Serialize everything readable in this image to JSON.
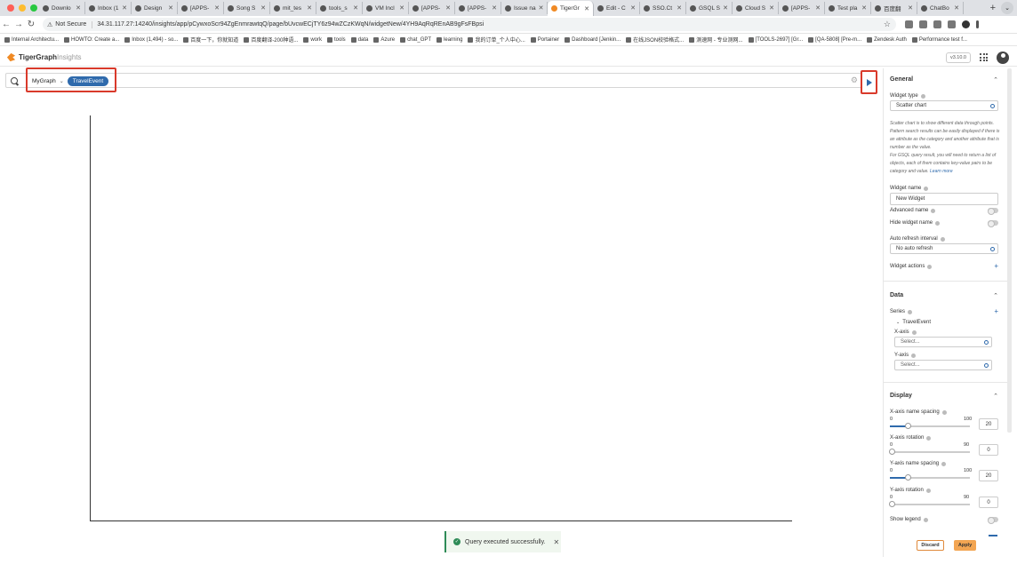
{
  "browser": {
    "tabs": [
      {
        "label": "Downlo"
      },
      {
        "label": "Inbox (1"
      },
      {
        "label": "Design"
      },
      {
        "label": "[APPS-"
      },
      {
        "label": "Song S"
      },
      {
        "label": "mit_tes"
      },
      {
        "label": "tools_s"
      },
      {
        "label": "VM Incl"
      },
      {
        "label": "[APPS-"
      },
      {
        "label": "[APPS-"
      },
      {
        "label": "Issue na"
      },
      {
        "label": "TigerGr"
      },
      {
        "label": "Edit - C"
      },
      {
        "label": "SSO.Ct"
      },
      {
        "label": "GSQL S"
      },
      {
        "label": "Cloud S"
      },
      {
        "label": "[APPS-"
      },
      {
        "label": "Test pla"
      },
      {
        "label": "百度翻"
      },
      {
        "label": "ChatBo"
      }
    ],
    "not_secure": "Not Secure",
    "url": "34.31.117.27:14240/insights/app/pCywxoScr94ZgEnmrawtqQ/page/bUvcwECjTY6z94wZCzKWqN/widgetNew/4YH9AqRqREnAB9gFsFBpsi",
    "bookmarks": [
      "Internal Architectu...",
      "HOWTO: Create a...",
      "Inbox (1,494) - so...",
      "百度一下，你就知道",
      "百度翻译-200种语...",
      "work",
      "tools",
      "data",
      "Azure",
      "chat_GPT",
      "learning",
      "我的订单_个人中心...",
      "Portainer",
      "Dashboard [Jenkin...",
      "在线JSON校验格式...",
      "测速网 - 专业测网...",
      "[TOOLS-2697] [Gr...",
      "[QA-5808] [Pre-m...",
      "Zendesk Auth",
      "Performance test f..."
    ]
  },
  "app": {
    "logo_brand": "TigerGraph",
    "logo_product": "Insights",
    "version": "v3.10.0"
  },
  "search": {
    "graph_name": "MyGraph",
    "vertex_chip": "TravelEvent"
  },
  "toast": {
    "message": "Query executed successfully."
  },
  "panel": {
    "general": {
      "title": "General",
      "widget_type_label": "Widget type",
      "widget_type_value": "Scatter chart",
      "help_lines": [
        "Scatter chart is to show different data through points.",
        "Pattern search results can be easily displayed if there is an attribute as the category and another attribute that is number as the value.",
        "For GSQL query result, you will need to return a list of objects, each of them contains key-value pairs to be category and value."
      ],
      "learn_more": "Learn more",
      "widget_name_label": "Widget name",
      "widget_name_value": "New Widget",
      "advanced_name_label": "Advanced name",
      "hide_widget_name_label": "Hide widget name",
      "auto_refresh_label": "Auto refresh interval",
      "auto_refresh_value": "No auto refresh",
      "widget_actions_label": "Widget actions"
    },
    "data": {
      "title": "Data",
      "series_label": "Series",
      "series_item": "TravelEvent",
      "x_axis_label": "X-axis",
      "x_axis_placeholder": "Select...",
      "y_axis_label": "Y-axis",
      "y_axis_placeholder": "Select..."
    },
    "display": {
      "title": "Display",
      "sliders": [
        {
          "label": "X-axis name spacing",
          "min": "0",
          "max": "100",
          "value": "20",
          "fraction": 0.2
        },
        {
          "label": "X-axis rotation",
          "min": "0",
          "max": "90",
          "value": "0",
          "fraction": 0
        },
        {
          "label": "Y-axis name spacing",
          "min": "0",
          "max": "100",
          "value": "20",
          "fraction": 0.2
        },
        {
          "label": "Y-axis rotation",
          "min": "0",
          "max": "90",
          "value": "0",
          "fraction": 0
        }
      ],
      "show_legend_label": "Show legend"
    },
    "discard": "Discard",
    "apply": "Apply"
  },
  "colors": {
    "accent": "#2f6aac",
    "highlight": "#d93a2b",
    "apply": "#f3a552",
    "success": "#2e8b57"
  }
}
